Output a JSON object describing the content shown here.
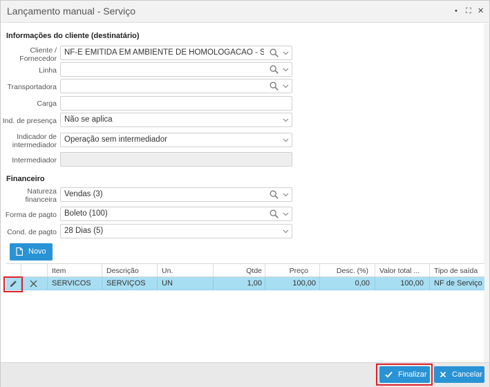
{
  "window": {
    "title": "Lançamento manual - Serviço",
    "controls": {
      "minimize": "•",
      "restore": "⛶",
      "close": "✕"
    }
  },
  "cliente_section": {
    "title": "Informações do cliente (destinatário)",
    "fields": {
      "cliente": {
        "label": "Cliente / Fornecedor",
        "value": "NF-E EMITIDA EM AMBIENTE DE HOMOLOGACAO - SEM VAL"
      },
      "linha": {
        "label": "Linha",
        "value": ""
      },
      "transportadora": {
        "label": "Transportadora",
        "value": ""
      },
      "carga": {
        "label": "Carga",
        "value": ""
      },
      "ind_presenca": {
        "label": "Ind. de presença",
        "value": "Não se aplica"
      },
      "indicador_intermediador": {
        "label": "Indicador de intermediador",
        "value": "Operação sem intermediador"
      },
      "intermediador": {
        "label": "Intermediador",
        "value": ""
      }
    }
  },
  "financeiro_section": {
    "title": "Financeiro",
    "fields": {
      "natureza": {
        "label": "Natureza financeira",
        "value": "Vendas (3)"
      },
      "forma_pagto": {
        "label": "Forma de pagto",
        "value": "Boleto (100)"
      },
      "cond_pagto": {
        "label": "Cond. de pagto",
        "value": "28 Dias (5)"
      }
    }
  },
  "novo_button": {
    "label": "Novo"
  },
  "grid": {
    "columns": [
      "Item",
      "Descrição",
      "Un.",
      "Qtde",
      "Preço",
      "Desc. (%)",
      "Valor total ...",
      "Tipo de saída"
    ],
    "rows": [
      {
        "item": "SERVICOS",
        "descricao": "SERVIÇOS",
        "un": "UN",
        "qtde": "1,00",
        "preco": "100,00",
        "desc": "0,00",
        "valor_total": "100,00",
        "tipo_saida": "NF de Serviço"
      }
    ]
  },
  "footer": {
    "finalizar_label": "Finalizar",
    "cancelar_label": "Cancelar"
  },
  "colors": {
    "accent": "#2a93d5",
    "row_selected": "#a8def2",
    "highlight": "#e0202a"
  }
}
